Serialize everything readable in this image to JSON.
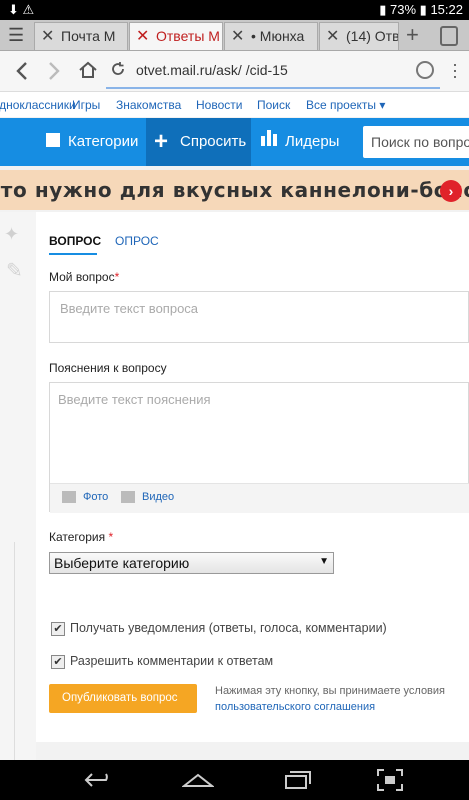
{
  "status": {
    "battery": "73%",
    "time": "15:22"
  },
  "tabs": [
    {
      "title": "Почта М",
      "active": false
    },
    {
      "title": "Ответы М",
      "active": true
    },
    {
      "title": "• Мюнха",
      "active": false
    },
    {
      "title": "(14) Отв",
      "active": false
    }
  ],
  "address": {
    "url": "otvet.mail.ru/ask/ /cid-15"
  },
  "sitenav": [
    "Одноклассники",
    "Игры",
    "Знакомства",
    "Новости",
    "Поиск",
    "Все проекты ▾"
  ],
  "bluebar": {
    "categories": "Категории",
    "ask": "Спросить",
    "leaders": "Лидеры",
    "search_placeholder": "Поиск по вопро"
  },
  "banner": {
    "text": "Что нужно для вкусных каннелони-болоньез?"
  },
  "form": {
    "tab_question": "ВОПРОС",
    "tab_poll": "ОПРОС",
    "my_question_label": "Мой вопрос",
    "required_mark": "*",
    "question_placeholder": "Введите текст вопроса",
    "explanation_label": "Пояснения к вопросу",
    "explanation_placeholder": "Введите текст пояснения",
    "photo_label": "Фото",
    "video_label": "Видео",
    "category_label": "Категория",
    "category_select": "Выберите категорию",
    "notify_label": "Получать уведомления (ответы, голоса, комментарии)",
    "allow_comments_label": "Разрешить комментарии к ответам",
    "publish_button": "Опубликовать вопрос",
    "agreement_text": "Нажимая эту кнопку, вы принимаете условия",
    "agreement_link": "пользовательского соглашения"
  },
  "colors": {
    "blue": "#168de2",
    "orange": "#f5a623",
    "banner": "#f6d8b9",
    "link": "#1f66b8"
  }
}
